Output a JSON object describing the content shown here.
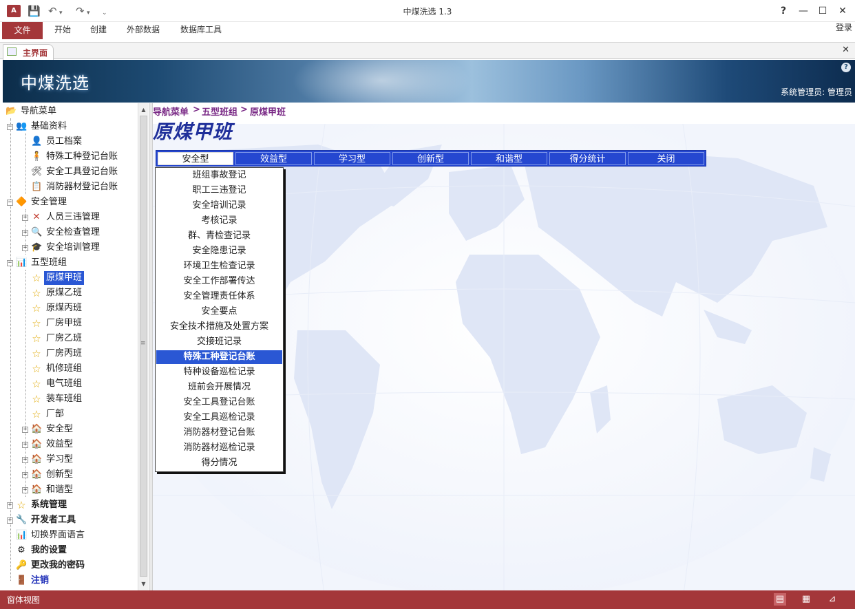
{
  "window": {
    "title": "中煤洗选 1.3",
    "app_logo": "A",
    "quick_access": [
      "save-icon",
      "undo-icon",
      "redo-icon",
      "customize-icon"
    ],
    "controls": {
      "help": "?",
      "minimize": "—",
      "maximize": "☐",
      "close": "✕"
    }
  },
  "ribbon": {
    "file": "文件",
    "tabs": [
      "开始",
      "创建",
      "外部数据",
      "数据库工具"
    ],
    "login": "登录"
  },
  "doc_tab": {
    "label": "主界面",
    "close": "✕"
  },
  "banner": {
    "app_name": "中煤洗选",
    "help": "?",
    "user": "系统管理员: 管理员"
  },
  "nav": {
    "items": [
      {
        "label": "导航菜单",
        "icon": "folder-open-icon",
        "glyph": "📂",
        "expander": "none"
      },
      {
        "label": "基础资料",
        "icon": "users-icon",
        "glyph": "👥",
        "expander": "minus"
      },
      {
        "label": "员工档案",
        "icon": "user-add-icon",
        "glyph": "👤",
        "expander": "none"
      },
      {
        "label": "特殊工种登记台账",
        "icon": "worker-icon",
        "glyph": "🧍",
        "expander": "none"
      },
      {
        "label": "安全工具登记台账",
        "icon": "tools-icon",
        "glyph": "🛠",
        "expander": "none"
      },
      {
        "label": "消防器材登记台账",
        "icon": "report-icon",
        "glyph": "📋",
        "expander": "none"
      },
      {
        "label": "安全管理",
        "icon": "shapes-icon",
        "glyph": "🔶",
        "expander": "minus"
      },
      {
        "label": "人员三违管理",
        "icon": "cross-icon",
        "glyph": "✕",
        "expander": "plus"
      },
      {
        "label": "安全检查管理",
        "icon": "magnifier-icon",
        "glyph": "🔍",
        "expander": "plus"
      },
      {
        "label": "安全培训管理",
        "icon": "training-icon",
        "glyph": "🎓",
        "expander": "plus"
      },
      {
        "label": "五型班组",
        "icon": "chart-icon",
        "glyph": "📊",
        "expander": "minus"
      },
      {
        "label": "原煤甲班",
        "icon": "star-icon",
        "glyph": "☆",
        "expander": "none",
        "selected": true
      },
      {
        "label": "原煤乙班",
        "icon": "star-icon",
        "glyph": "☆",
        "expander": "none"
      },
      {
        "label": "原煤丙班",
        "icon": "star-icon",
        "glyph": "☆",
        "expander": "none"
      },
      {
        "label": "厂房甲班",
        "icon": "star-icon",
        "glyph": "☆",
        "expander": "none"
      },
      {
        "label": "厂房乙班",
        "icon": "star-icon",
        "glyph": "☆",
        "expander": "none"
      },
      {
        "label": "厂房丙班",
        "icon": "star-icon",
        "glyph": "☆",
        "expander": "none"
      },
      {
        "label": "机修班组",
        "icon": "star-icon",
        "glyph": "☆",
        "expander": "none"
      },
      {
        "label": "电气班组",
        "icon": "star-icon",
        "glyph": "☆",
        "expander": "none"
      },
      {
        "label": "装车班组",
        "icon": "star-icon",
        "glyph": "☆",
        "expander": "none"
      },
      {
        "label": "厂部",
        "icon": "star-icon",
        "glyph": "☆",
        "expander": "none"
      },
      {
        "label": "安全型",
        "icon": "house-icon",
        "glyph": "🏠",
        "expander": "plus"
      },
      {
        "label": "效益型",
        "icon": "house-icon",
        "glyph": "🏠",
        "expander": "plus"
      },
      {
        "label": "学习型",
        "icon": "house-icon",
        "glyph": "🏠",
        "expander": "plus"
      },
      {
        "label": "创新型",
        "icon": "house-icon",
        "glyph": "🏠",
        "expander": "plus"
      },
      {
        "label": "和谐型",
        "icon": "house-icon",
        "glyph": "🏠",
        "expander": "plus"
      },
      {
        "label": "系统管理",
        "icon": "star-icon",
        "glyph": "☆",
        "expander": "plus"
      },
      {
        "label": "开发者工具",
        "icon": "tools-icon",
        "glyph": "🔧",
        "expander": "plus"
      },
      {
        "label": "切换界面语言",
        "icon": "chart-icon",
        "glyph": "📊",
        "expander": "none"
      },
      {
        "label": "我的设置",
        "icon": "settings-icon",
        "glyph": "⚙",
        "expander": "none"
      },
      {
        "label": "更改我的密码",
        "icon": "user-key-icon",
        "glyph": "🔑",
        "expander": "none"
      },
      {
        "label": "注销",
        "icon": "logout-icon",
        "glyph": "🚪",
        "expander": "none"
      }
    ]
  },
  "main": {
    "breadcrumb": [
      "导航菜单",
      ">",
      "五型班组",
      ">",
      "原煤甲班"
    ],
    "title": "原煤甲班",
    "menu_tabs": [
      "安全型",
      "效益型",
      "学习型",
      "创新型",
      "和谐型",
      "得分统计",
      "关闭"
    ],
    "active_tab": "安全型",
    "dropdown": [
      "班组事故登记",
      "职工三违登记",
      "安全培训记录",
      "考核记录",
      "群、青检查记录",
      "安全隐患记录",
      "环境卫生检查记录",
      "安全工作部署传达",
      "安全管理责任体系",
      "安全要点",
      "安全技术措施及处置方案",
      "交接班记录",
      "特殊工种登记台账",
      "特种设备巡检记录",
      "班前会开展情况",
      "安全工具登记台账",
      "安全工具巡检记录",
      "消防器材登记台账",
      "消防器材巡检记录",
      "得分情况"
    ],
    "dropdown_highlight": "特殊工种登记台账"
  },
  "status": {
    "text": "窗体视图",
    "views": [
      "form-view-icon",
      "datasheet-view-icon",
      "layout-view-icon"
    ]
  },
  "colors": {
    "accent": "#a4373a",
    "menubar": "#2547d0",
    "selection": "#2a57d4",
    "title": "#1f2f9a",
    "breadcrumb": "#7a2a86"
  }
}
